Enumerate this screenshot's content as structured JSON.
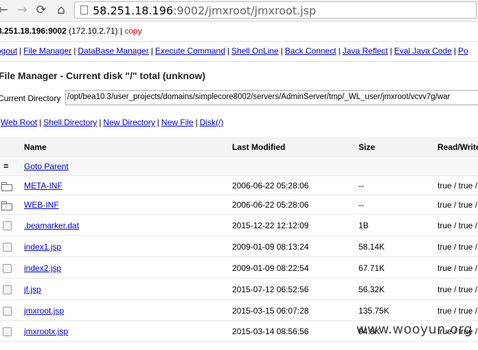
{
  "browser": {
    "url_host": "58.251.18.196",
    "url_rest": ":9002/jmxroot/jmxroot.jsp"
  },
  "info": {
    "host": "8.251.18.196:9002",
    "ip": "(172.10.2.71)",
    "separator": "|",
    "copy": "copy"
  },
  "menu": [
    "ogout",
    "File Manager",
    "DataBase Manager",
    "Execute Command",
    "Shell OnLine",
    "Back Connect",
    "Java Reflect",
    "Eval Java Code",
    "Po"
  ],
  "title": "File Manager - Current disk \"/\" total (unknow)",
  "current_directory": {
    "label": "Current Directory",
    "value": "/opt/bea10.3/user_projects/domains/simplecore8002/servers/AdminServer/tmp/_WL_user/jmxroot/vcvv7g/war"
  },
  "actions": [
    "Web Root",
    "Shell Directory",
    "New Directory",
    "New File",
    "Disk(/)"
  ],
  "table": {
    "headers": {
      "name": "Name",
      "modified": "Last Modified",
      "size": "Size",
      "perm": "Read/Write"
    },
    "rows": [
      {
        "icon": "parent",
        "name": "Goto Parent",
        "modified": "",
        "size": "",
        "perm": ""
      },
      {
        "icon": "folder",
        "name": "META-INF",
        "modified": "2006-06-22 05:28:06",
        "size": "--",
        "perm": "true / true /"
      },
      {
        "icon": "folder",
        "name": "WEB-INF",
        "modified": "2006-06-22 05:28:06",
        "size": "--",
        "perm": "true / true /"
      },
      {
        "icon": "checkbox",
        "name": ".beamarker.dat",
        "modified": "2015-12-22 12:12:09",
        "size": "1B",
        "perm": "true / true /"
      },
      {
        "icon": "checkbox",
        "name": "index1.jsp",
        "modified": "2009-01-09 08:13:24",
        "size": "58.14K",
        "perm": "true / true /"
      },
      {
        "icon": "checkbox",
        "name": "index2.jsp",
        "modified": "2009-01-09 08:22:54",
        "size": "67.71K",
        "perm": "true / true /"
      },
      {
        "icon": "checkbox",
        "name": "jf.jsp",
        "modified": "2015-07-12 06:52:56",
        "size": "56.32K",
        "perm": "true / true /"
      },
      {
        "icon": "checkbox",
        "name": "jmxroot.jsp",
        "modified": "2015-03-15 06:07:28",
        "size": "135.75K",
        "perm": "true / true /"
      },
      {
        "icon": "checkbox",
        "name": "jmxrootx.jsp",
        "modified": "2015-03-14 08:56:56",
        "size": "94.8K",
        "perm": "true / true /"
      }
    ]
  },
  "watermark": "www.wooyun.org"
}
